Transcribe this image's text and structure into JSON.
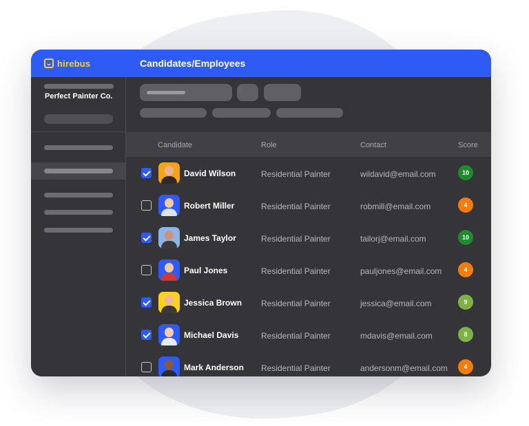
{
  "app": {
    "brand": "hirebus",
    "page_title": "Candidates/Employees"
  },
  "sidebar": {
    "company_name": "Perfect Painter Co."
  },
  "colors": {
    "brand_blue": "#2e5bf5",
    "brand_yellow": "#ffd21f",
    "score_high": "#1f8b2c",
    "score_mid": "#7cb342",
    "score_low": "#f57c0a"
  },
  "table": {
    "headers": {
      "candidate": "Candidate",
      "role": "Role",
      "contact": "Contact",
      "score": "Score"
    },
    "rows": [
      {
        "checked": true,
        "name": "David Wilson",
        "role": "Residential Painter",
        "contact": "wildavid@email.com",
        "score": "10",
        "score_color": "#1f8b2c",
        "avatar_bg": "#f6a21b",
        "avatar_skin": "#e8b48f",
        "avatar_shirt": "#2b2b2b"
      },
      {
        "checked": false,
        "name": "Robert Miller",
        "role": "Residential Painter",
        "contact": "robmill@email.com",
        "score": "4",
        "score_color": "#f57c0a",
        "avatar_bg": "#2e5bf5",
        "avatar_skin": "#f1c9a8",
        "avatar_shirt": "#dfe3ea"
      },
      {
        "checked": true,
        "name": "James Taylor",
        "role": "Residential Painter",
        "contact": "tailorj@email.com",
        "score": "10",
        "score_color": "#1f8b2c",
        "avatar_bg": "#8fb4e8",
        "avatar_skin": "#c99872",
        "avatar_shirt": "#3a3a3a"
      },
      {
        "checked": false,
        "name": "Paul Jones",
        "role": "Residential Painter",
        "contact": "pauljones@email.com",
        "score": "4",
        "score_color": "#f57c0a",
        "avatar_bg": "#2e5bf5",
        "avatar_skin": "#f0c7a4",
        "avatar_shirt": "#d23a2e"
      },
      {
        "checked": true,
        "name": "Jessica Brown",
        "role": "Residential Painter",
        "contact": "jessica@email.com",
        "score": "9",
        "score_color": "#7cb342",
        "avatar_bg": "#ffd21f",
        "avatar_skin": "#eab995",
        "avatar_shirt": "#3b3b3b"
      },
      {
        "checked": true,
        "name": "Michael Davis",
        "role": "Residential Painter",
        "contact": "mdavis@email.com",
        "score": "8",
        "score_color": "#7cb342",
        "avatar_bg": "#2e5bf5",
        "avatar_skin": "#f2cdb0",
        "avatar_shirt": "#e8ebf0"
      },
      {
        "checked": false,
        "name": "Mark Anderson",
        "role": "Residential Painter",
        "contact": "andersonm@email.com",
        "score": "4",
        "score_color": "#f57c0a",
        "avatar_bg": "#2e5bf5",
        "avatar_skin": "#8a5a3c",
        "avatar_shirt": "#2b2b2b"
      }
    ]
  }
}
